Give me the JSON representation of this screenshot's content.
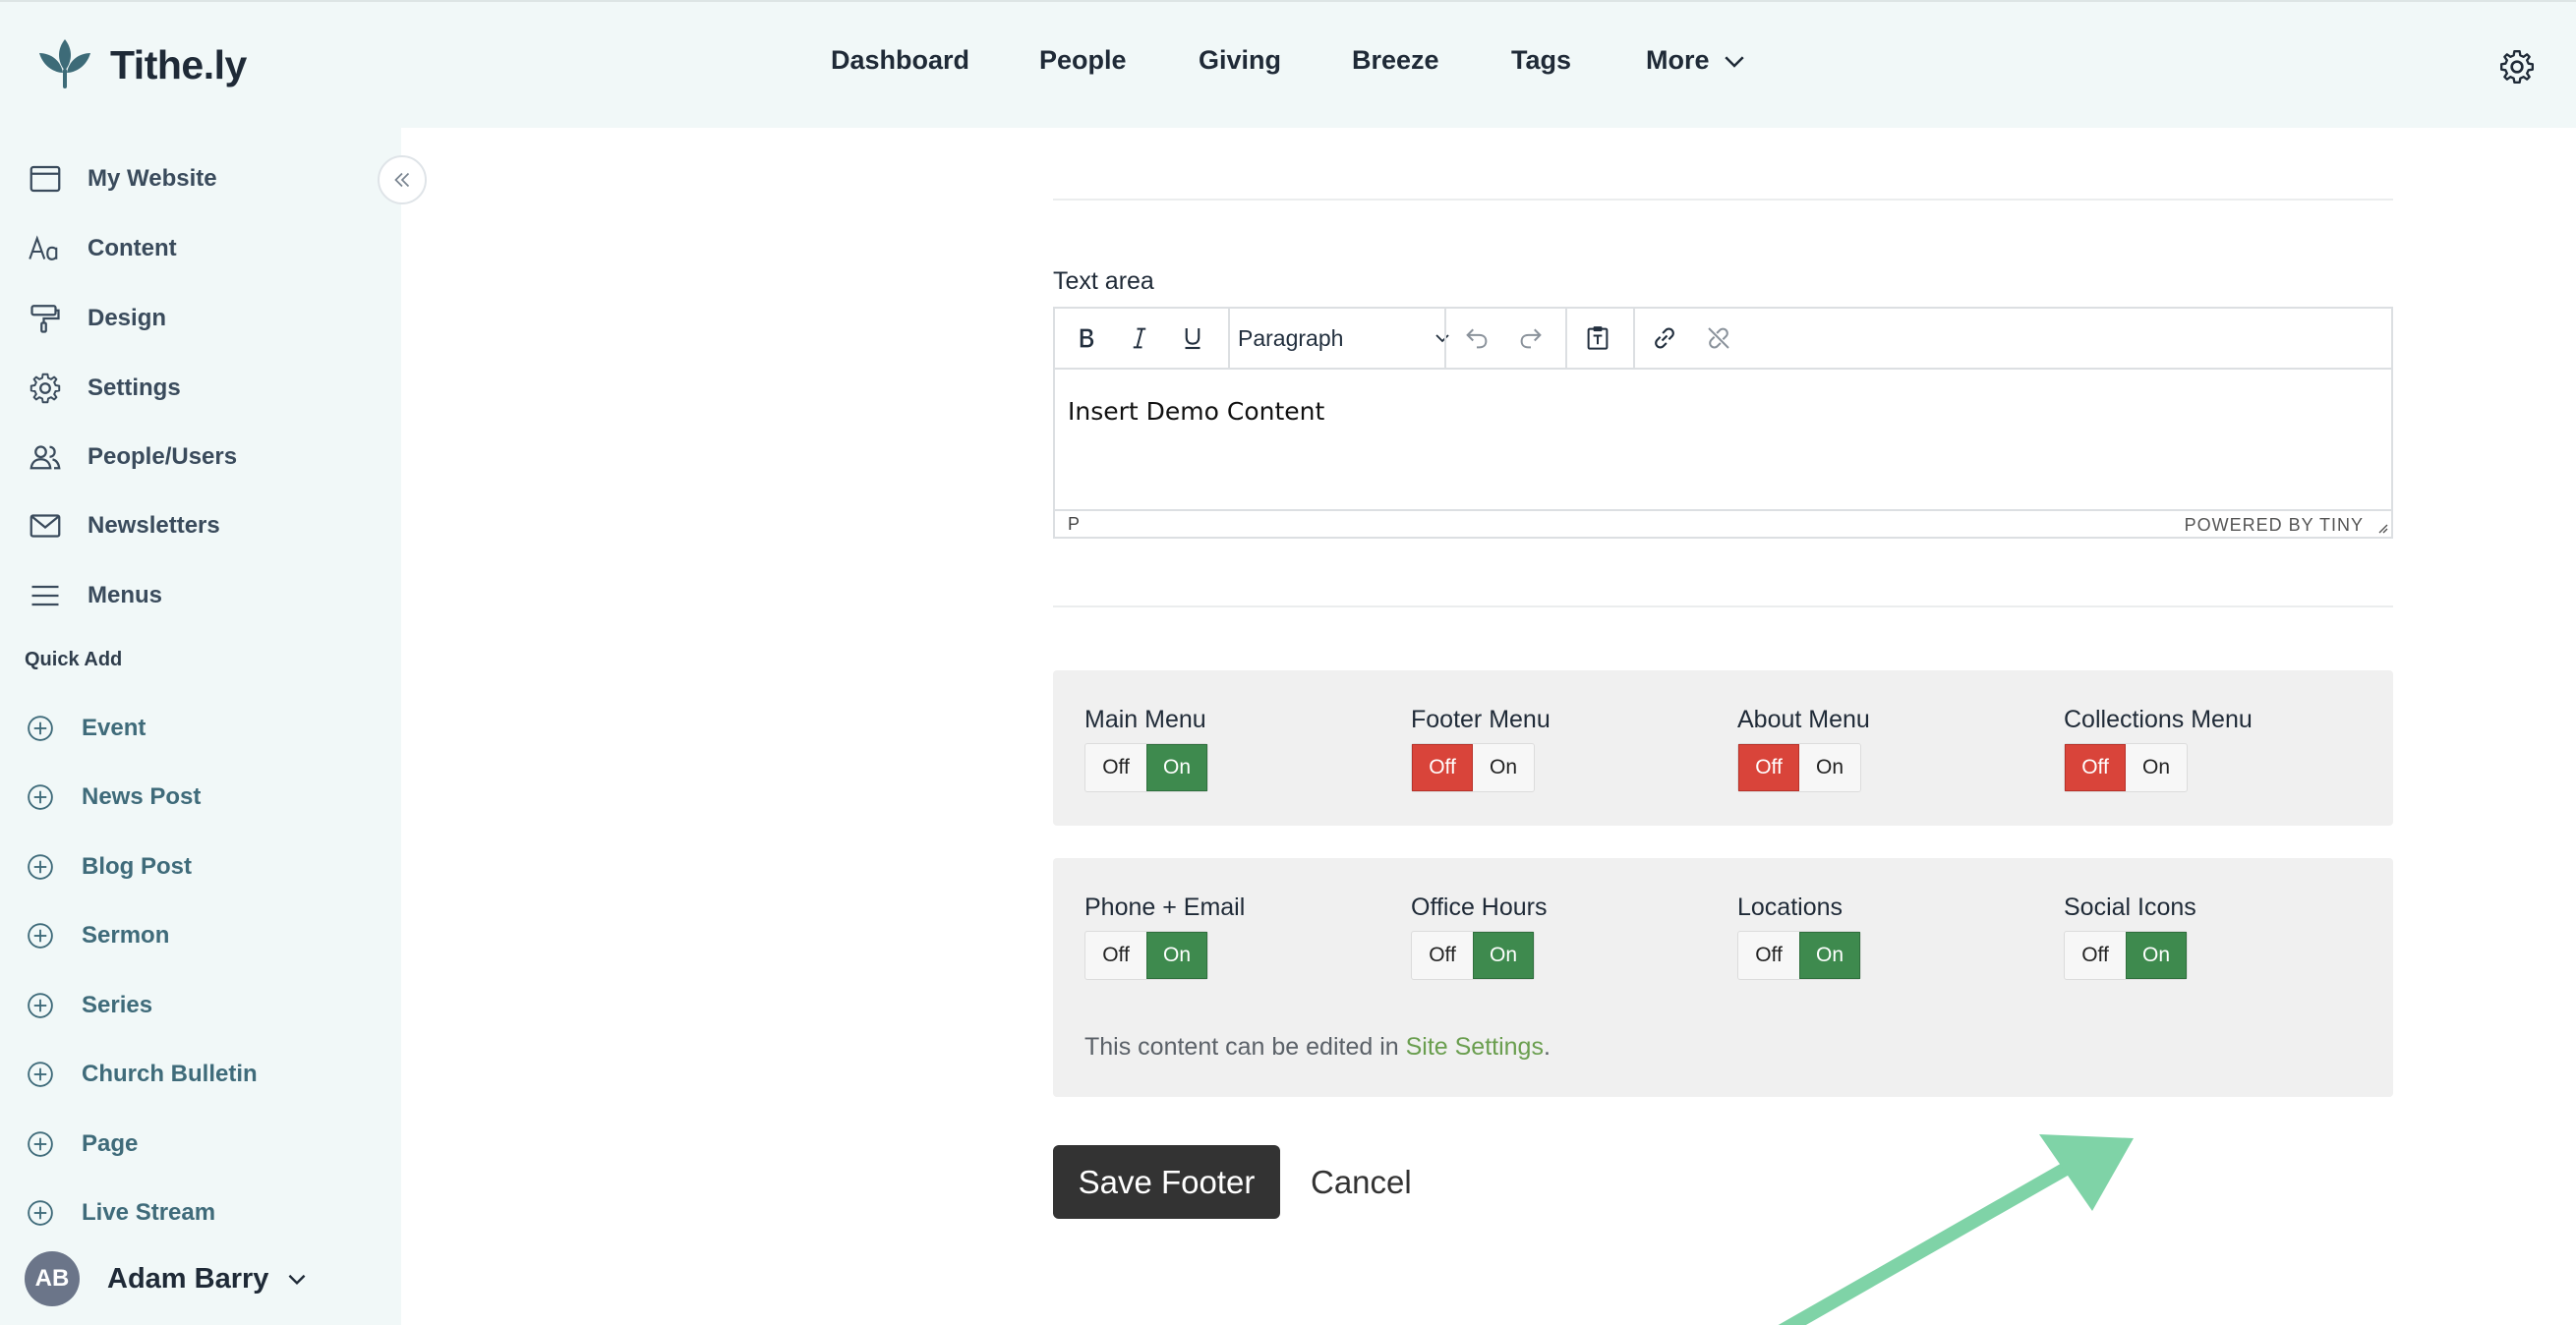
{
  "brand": {
    "name": "Tithe.ly"
  },
  "nav": {
    "items": [
      "Dashboard",
      "People",
      "Giving",
      "Breeze",
      "Tags"
    ],
    "more_label": "More"
  },
  "sidebar": {
    "items": [
      {
        "label": "My Website",
        "icon": "browser-window-icon"
      },
      {
        "label": "Content",
        "icon": "font-aa-icon"
      },
      {
        "label": "Design",
        "icon": "paint-roller-icon"
      },
      {
        "label": "Settings",
        "icon": "gear-icon"
      },
      {
        "label": "People/Users",
        "icon": "users-icon"
      },
      {
        "label": "Newsletters",
        "icon": "envelope-icon"
      },
      {
        "label": "Menus",
        "icon": "hamburger-icon"
      }
    ],
    "quick_add_label": "Quick Add",
    "quick_add_items": [
      "Event",
      "News Post",
      "Blog Post",
      "Sermon",
      "Series",
      "Church Bulletin",
      "Page",
      "Live Stream"
    ]
  },
  "user": {
    "initials": "AB",
    "name": "Adam Barry"
  },
  "editor": {
    "label": "Text area",
    "format_select": "Paragraph",
    "content": "Insert Demo Content",
    "status_path": "P",
    "powered_by": "POWERED BY TINY"
  },
  "toggles_row1": [
    {
      "title": "Main Menu",
      "off": "Off",
      "on": "On",
      "state": "on"
    },
    {
      "title": "Footer Menu",
      "off": "Off",
      "on": "On",
      "state": "off"
    },
    {
      "title": "About Menu",
      "off": "Off",
      "on": "On",
      "state": "off"
    },
    {
      "title": "Collections Menu",
      "off": "Off",
      "on": "On",
      "state": "off"
    }
  ],
  "toggles_row2": [
    {
      "title": "Phone + Email",
      "off": "Off",
      "on": "On",
      "state": "on"
    },
    {
      "title": "Office Hours",
      "off": "Off",
      "on": "On",
      "state": "on"
    },
    {
      "title": "Locations",
      "off": "Off",
      "on": "On",
      "state": "on"
    },
    {
      "title": "Social Icons",
      "off": "Off",
      "on": "On",
      "state": "on"
    }
  ],
  "note": {
    "text": "This content can be edited in ",
    "link": "Site Settings",
    "suffix": "."
  },
  "actions": {
    "save": "Save Footer",
    "cancel": "Cancel"
  },
  "colors": {
    "on": "#3e8a4e",
    "off": "#d9443a",
    "arrow": "#7fd3a7",
    "accent_link": "#6a9e4f"
  }
}
